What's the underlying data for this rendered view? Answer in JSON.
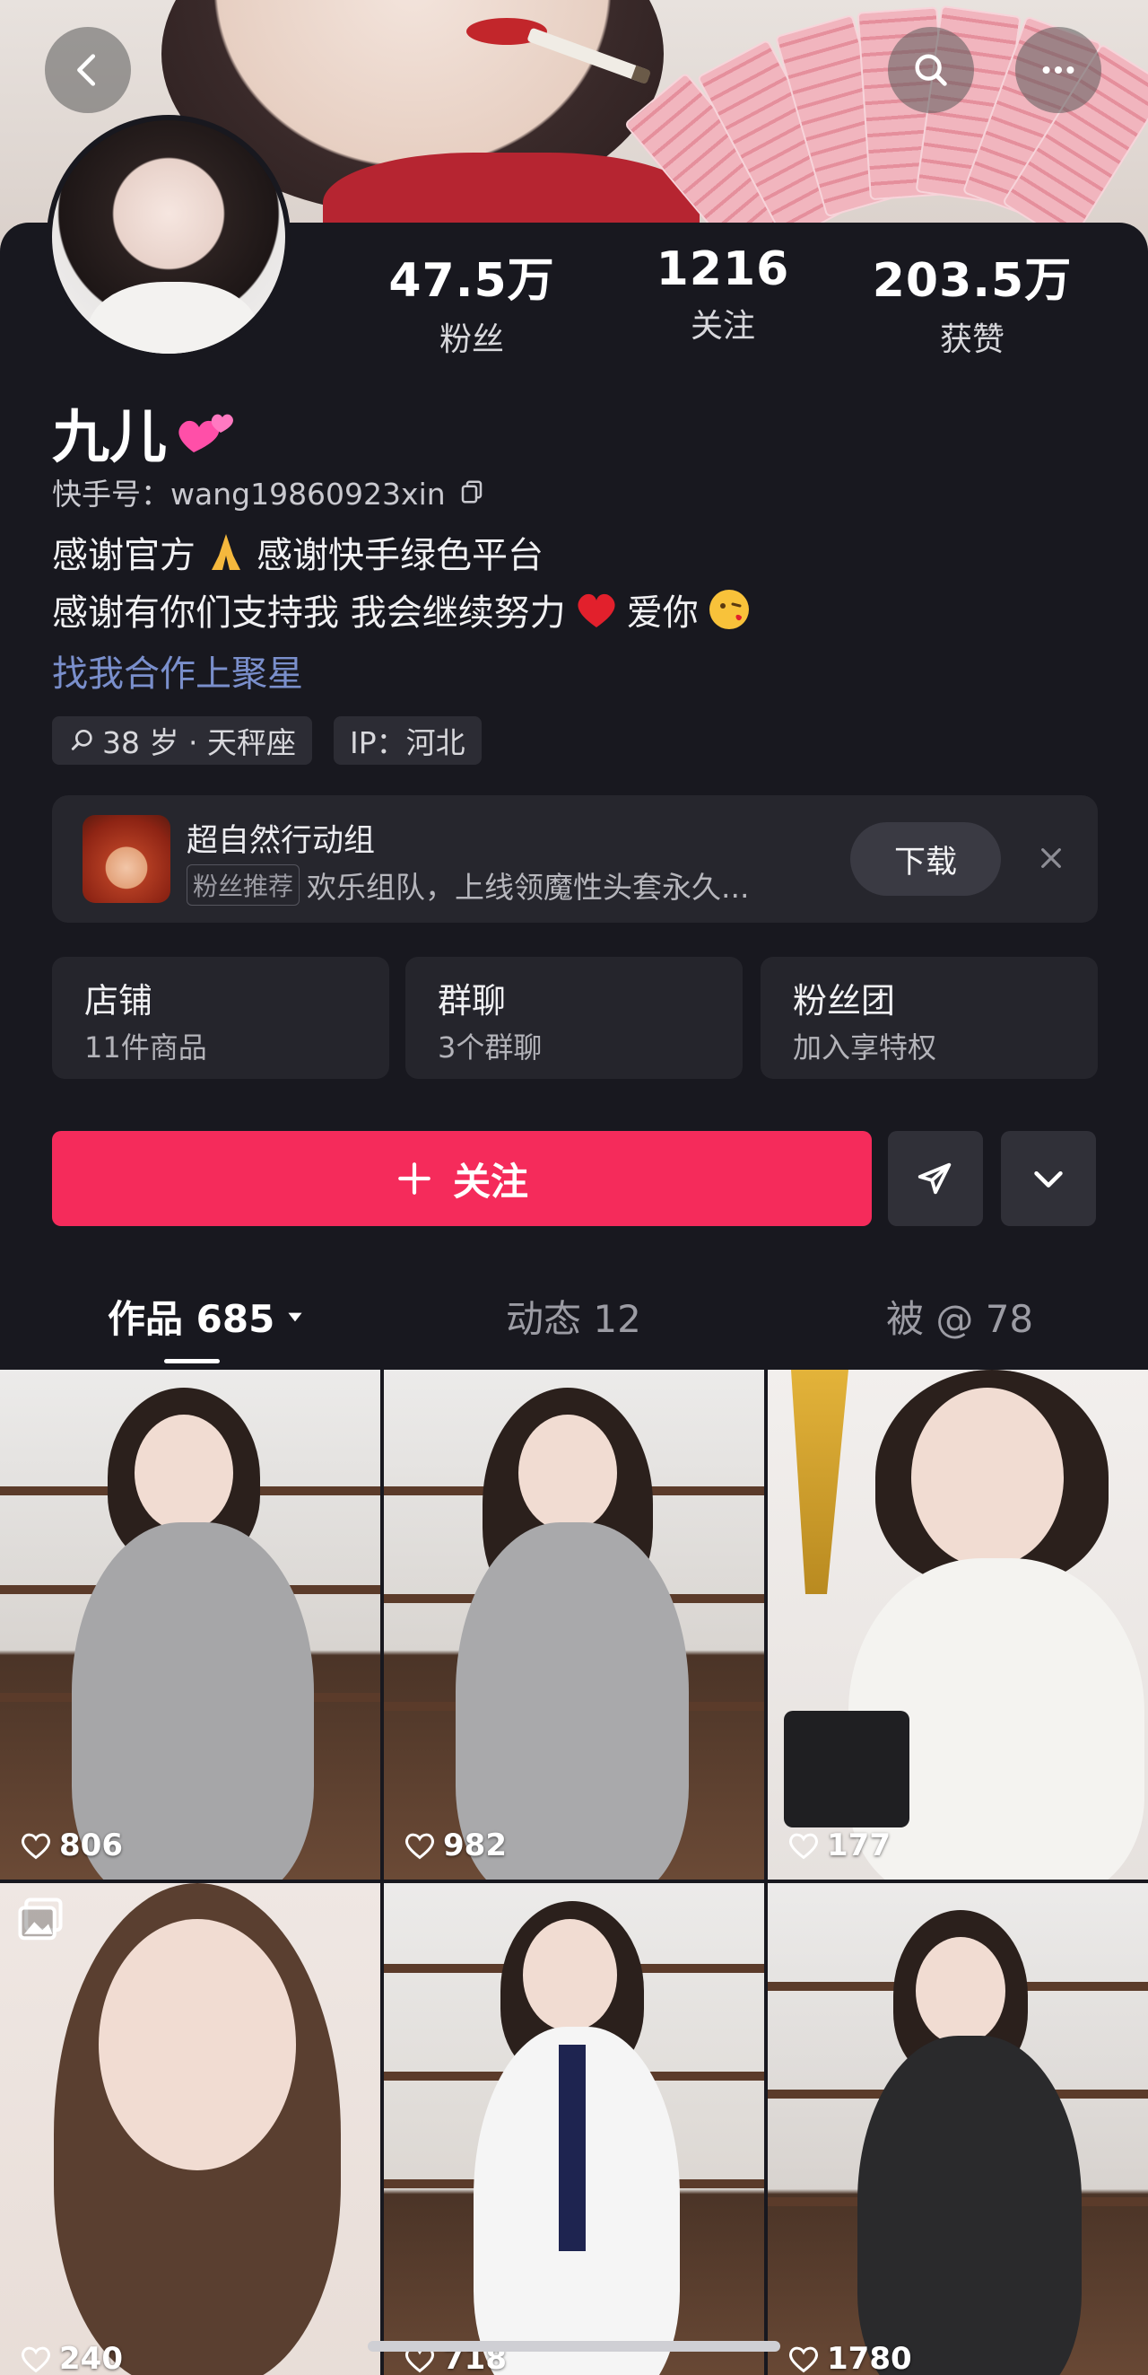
{
  "profile": {
    "name": "九儿",
    "kuaishou_id": "快手号：wang19860923xin",
    "bio_line1": "感谢官方",
    "bio_line1b": "感谢快手绿色平台",
    "bio_line2": "感谢有你们支持我   我会继续努力",
    "bio_line2b": "爱你",
    "link": "找我合作上聚星",
    "tags": [
      "38 岁 · 天秤座",
      "IP：河北"
    ]
  },
  "stats": [
    {
      "value": "47.5万",
      "label": "粉丝"
    },
    {
      "value": "1216",
      "label": "关注"
    },
    {
      "value": "203.5万",
      "label": "获赞"
    }
  ],
  "promo": {
    "title": "超自然行动组",
    "badge": "粉丝推荐",
    "desc": "欢乐组队，上线领魔性头套永久...",
    "download": "下载"
  },
  "shortcuts": [
    {
      "title": "店铺",
      "subtitle": "11件商品"
    },
    {
      "title": "群聊",
      "subtitle": "3个群聊"
    },
    {
      "title": "粉丝团",
      "subtitle": "加入享特权"
    }
  ],
  "actions": {
    "follow": "关注"
  },
  "tabs": [
    {
      "label": "作品 685",
      "active": true
    },
    {
      "label": "动态 12",
      "active": false
    },
    {
      "label": "被 @ 78",
      "active": false
    }
  ],
  "videos": [
    {
      "likes": "806"
    },
    {
      "likes": "982"
    },
    {
      "likes": "177"
    },
    {
      "likes": "240"
    },
    {
      "likes": "718"
    },
    {
      "likes": "1780"
    }
  ],
  "colors": {
    "background": "#18181f",
    "accent": "#f52b5b",
    "link": "#7a8fcc"
  },
  "icons": [
    "back-icon",
    "search-icon",
    "more-icon",
    "copy-icon",
    "search-small-icon",
    "close-icon",
    "plus-icon",
    "send-icon",
    "chevron-down-icon",
    "heart-outline-icon",
    "image-album-icon"
  ]
}
